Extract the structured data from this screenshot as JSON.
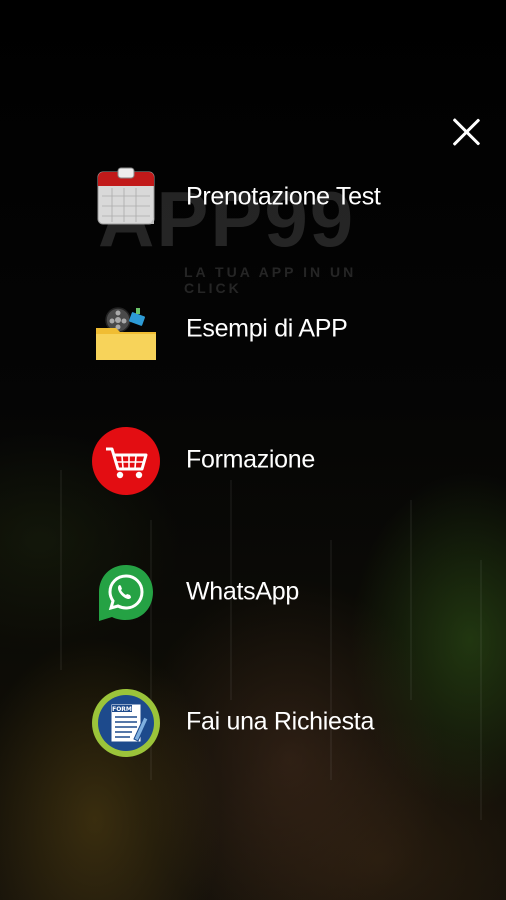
{
  "watermark": {
    "text": "APP99",
    "tagline": "LA TUA APP IN UN CLICK"
  },
  "menu": {
    "items": [
      {
        "label": "Prenotazione Test",
        "icon": "calendar-icon"
      },
      {
        "label": "Esempi di APP",
        "icon": "film-folder-icon"
      },
      {
        "label": "Formazione",
        "icon": "shopping-cart-icon"
      },
      {
        "label": "WhatsApp",
        "icon": "whatsapp-icon"
      },
      {
        "label": "Fai una Richiesta",
        "icon": "form-icon"
      }
    ]
  },
  "close": {
    "icon": "close-icon"
  },
  "colors": {
    "background": "#000000",
    "text": "#ffffff",
    "cart_red": "#e30d12",
    "whatsapp_green": "#25a244",
    "form_ring": "#9bc43a",
    "folder_yellow": "#f5c944"
  }
}
